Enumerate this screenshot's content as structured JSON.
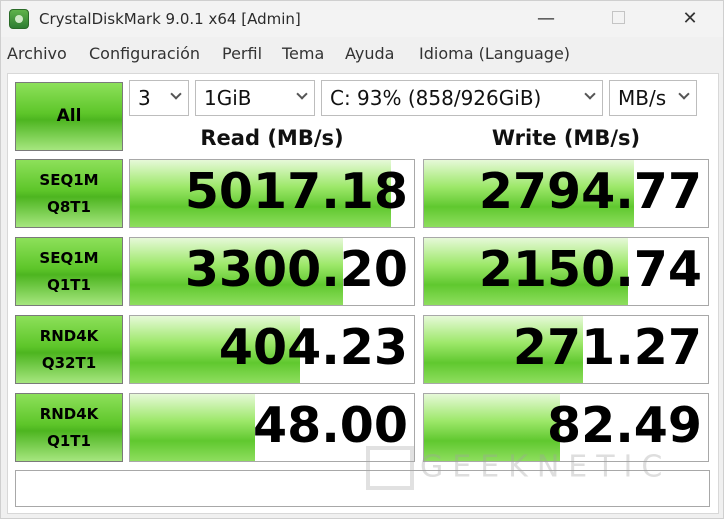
{
  "window": {
    "title": "CrystalDiskMark 9.0.1 x64 [Admin]",
    "minimize_glyph": "—",
    "close_glyph": "✕"
  },
  "menu": [
    "Archivo",
    "Configuración",
    "Perfil",
    "Tema",
    "Ayuda",
    "Idioma (Language)"
  ],
  "controls": {
    "all_label": "All",
    "count": "3",
    "size": "1GiB",
    "drive": "C: 93% (858/926GiB)",
    "unit": "MB/s"
  },
  "headers": {
    "read": "Read (MB/s)",
    "write": "Write (MB/s)"
  },
  "tests": [
    {
      "line1": "SEQ1M",
      "line2": "Q8T1",
      "read": "5017.18",
      "write": "2794.77",
      "read_fill": 0.92,
      "write_fill": 0.74
    },
    {
      "line1": "SEQ1M",
      "line2": "Q1T1",
      "read": "3300.20",
      "write": "2150.74",
      "read_fill": 0.75,
      "write_fill": 0.72
    },
    {
      "line1": "RND4K",
      "line2": "Q32T1",
      "read": "404.23",
      "write": "271.27",
      "read_fill": 0.6,
      "write_fill": 0.56
    },
    {
      "line1": "RND4K",
      "line2": "Q1T1",
      "read": "48.00",
      "write": "82.49",
      "read_fill": 0.44,
      "write_fill": 0.48
    }
  ],
  "comment": "",
  "watermark": "GEEKNETIC"
}
